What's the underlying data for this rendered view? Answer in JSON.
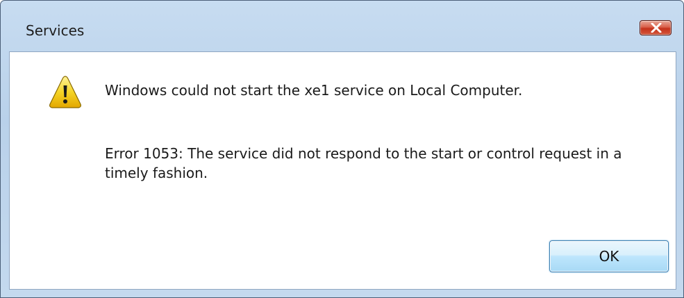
{
  "window": {
    "title": "Services"
  },
  "dialog": {
    "icon": "warning-icon",
    "message_primary": "Windows could not start the xe1 service on Local Computer.",
    "message_secondary": "Error 1053: The service did not respond to the start or control request in a timely fashion."
  },
  "buttons": {
    "ok_label": "OK",
    "close_icon": "close-icon"
  },
  "colors": {
    "frame": "#b9d1ea",
    "close_button": "#c5311b",
    "ok_button": "#bee6fd",
    "warning_yellow": "#f5d426"
  }
}
